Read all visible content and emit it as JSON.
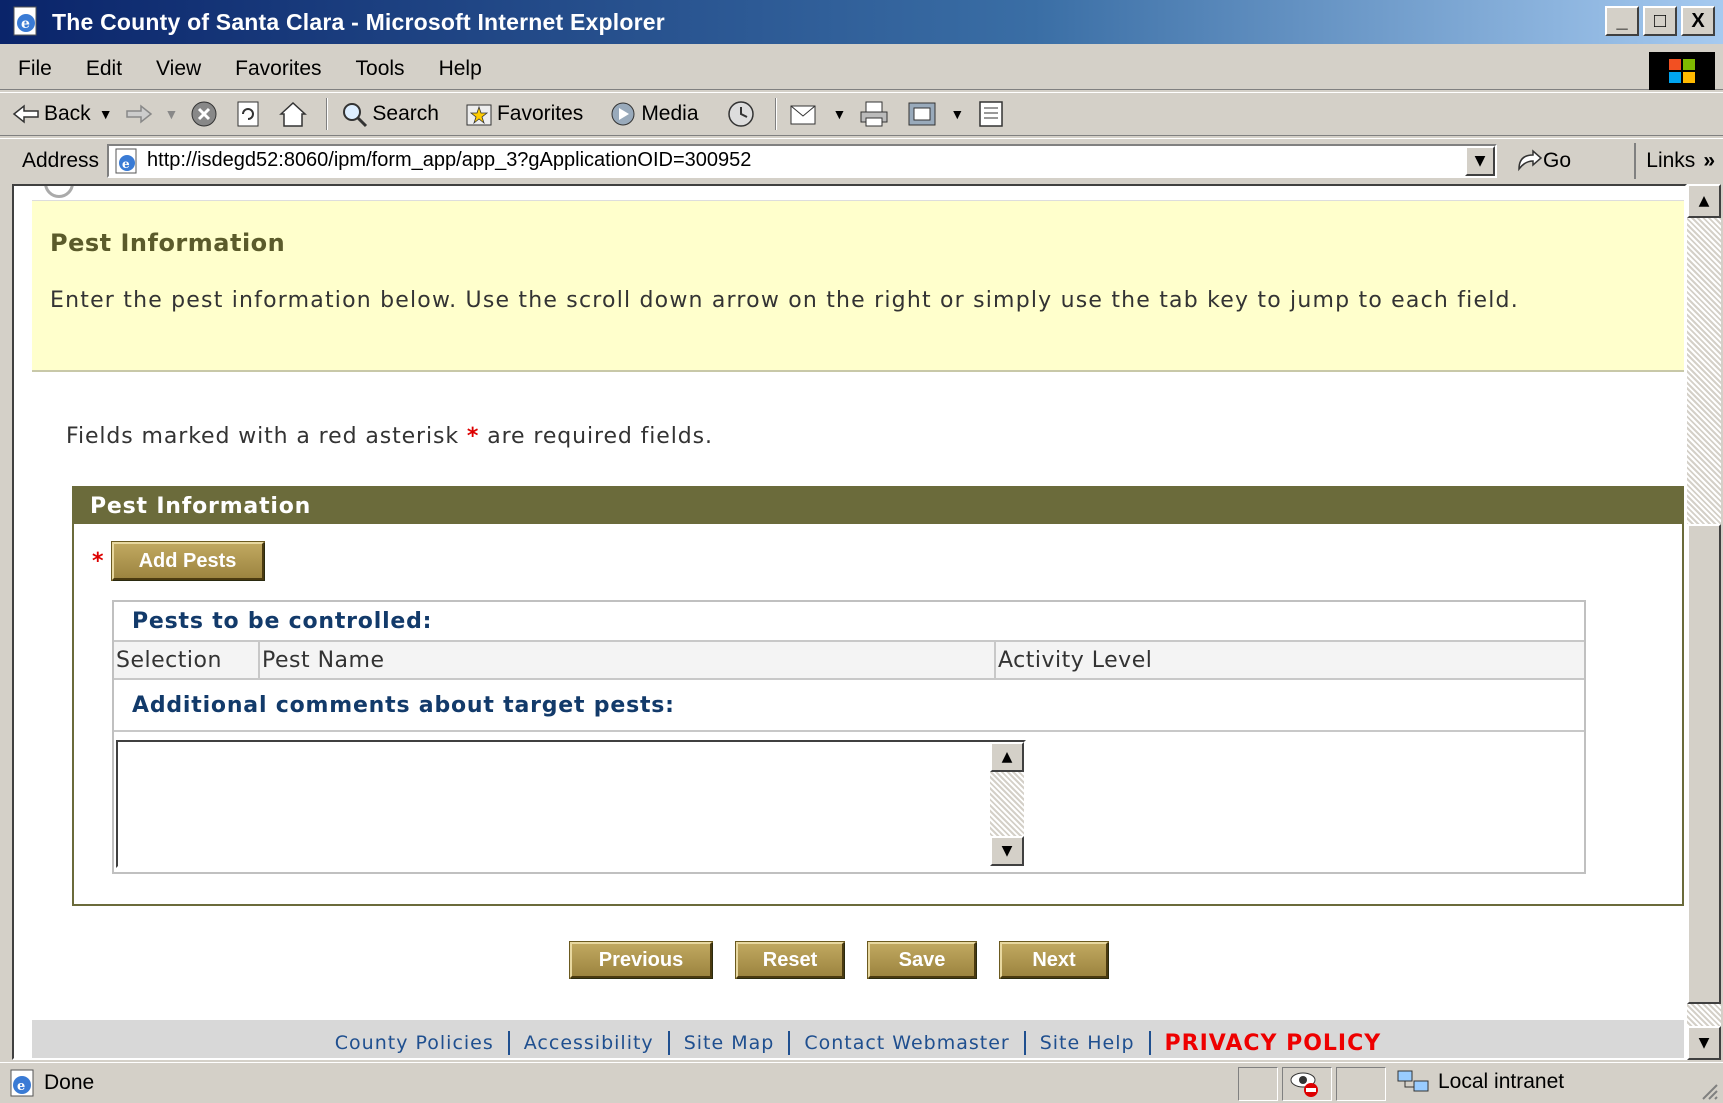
{
  "window": {
    "title": "The County of Santa Clara - Microsoft Internet Explorer",
    "minimize": "_",
    "maximize": "□",
    "close": "X"
  },
  "menu": [
    "File",
    "Edit",
    "View",
    "Favorites",
    "Tools",
    "Help"
  ],
  "toolbar": {
    "back": "Back",
    "search": "Search",
    "favorites": "Favorites",
    "media": "Media"
  },
  "address": {
    "label": "Address",
    "url": "http://isdegd52:8060/ipm/form_app/app_3?gApplicationOID=300952",
    "go": "Go",
    "links": "Links"
  },
  "intro": {
    "title": "Pest Information",
    "text": "Enter the pest information below. Use the scroll down arrow on the right or simply use the tab key to jump to each field."
  },
  "required_note": {
    "before": "Fields marked with a red asterisk ",
    "star": "*",
    "after": " are required fields."
  },
  "section": {
    "header": "Pest Information",
    "add_star": "*",
    "add_button": "Add Pests",
    "pests_title": "Pests to be controlled:",
    "columns": [
      "Selection",
      "Pest Name",
      "Activity Level"
    ],
    "comments_title": "Additional comments about target pests:",
    "comments_value": ""
  },
  "nav_buttons": {
    "previous": "Previous",
    "reset": "Reset",
    "save": "Save",
    "next": "Next"
  },
  "footer": {
    "links": [
      "County Policies",
      "Accessibility",
      "Site Map",
      "Contact Webmaster",
      "Site Help"
    ],
    "privacy": "PRIVACY POLICY"
  },
  "status": {
    "text": "Done",
    "zone": "Local intranet"
  },
  "colors": {
    "titlebar": "#0a246a",
    "intro_bg": "#ffffcc",
    "section_header": "#6b6b3b",
    "button_olive": "#9c8440",
    "link": "#1f4f8f",
    "privacy": "#e00000",
    "required": "#dd0000"
  }
}
